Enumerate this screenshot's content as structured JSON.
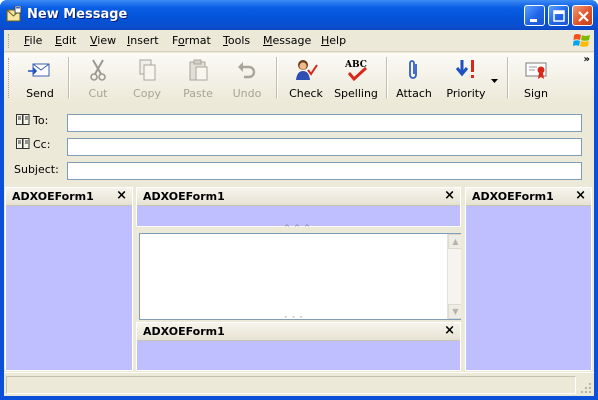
{
  "window": {
    "title": "New Message",
    "buttons": {
      "minimize": "minimize",
      "maximize": "maximize",
      "close": "close"
    }
  },
  "menu": [
    {
      "label": "File",
      "accel": "F",
      "rest": "ile"
    },
    {
      "label": "Edit",
      "accel": "E",
      "rest": "dit"
    },
    {
      "label": "View",
      "accel": "V",
      "rest": "iew"
    },
    {
      "label": "Insert",
      "accel": "I",
      "rest": "nsert"
    },
    {
      "label": "Format",
      "accel": "o",
      "pre": "F",
      "rest": "rmat"
    },
    {
      "label": "Tools",
      "accel": "T",
      "rest": "ools"
    },
    {
      "label": "Message",
      "accel": "M",
      "rest": "essage"
    },
    {
      "label": "Help",
      "accel": "H",
      "rest": "elp"
    }
  ],
  "toolbar": {
    "send": "Send",
    "cut": "Cut",
    "copy": "Copy",
    "paste": "Paste",
    "undo": "Undo",
    "check": "Check",
    "spelling": "Spelling",
    "spelling_icon_text": "ABC",
    "attach": "Attach",
    "priority": "Priority",
    "sign": "Sign",
    "overflow": "»"
  },
  "header": {
    "to_label": "To:",
    "cc_label": "Cc:",
    "subject_label": "Subject:",
    "to_value": "",
    "cc_value": "",
    "subject_value": ""
  },
  "panes": {
    "left_title": "ADXOEForm1",
    "top_title": "ADXOEForm1",
    "right_title": "ADXOEForm1",
    "bottom_title": "ADXOEForm1",
    "close_glyph": "×"
  },
  "colors": {
    "pane_fill": "#bfbfff",
    "titlebar": "#0453d8",
    "face": "#ece9d8"
  }
}
